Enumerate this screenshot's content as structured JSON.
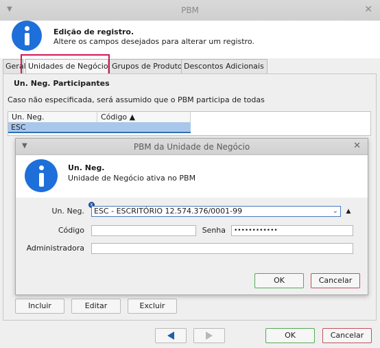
{
  "window": {
    "title": "PBM"
  },
  "header": {
    "title": "Edição de registro.",
    "subtitle": "Altere os campos desejados para alterar um registro."
  },
  "tabs": [
    {
      "label": "Geral"
    },
    {
      "label": "Unidades de Negócio"
    },
    {
      "label": "Grupos de Produto"
    },
    {
      "label": "Descontos Adicionais"
    }
  ],
  "section": {
    "title": "Un. Neg. Participantes",
    "note": "Caso não especificada, será assumido que o PBM participa de todas"
  },
  "grid": {
    "columns": [
      "Un. Neg.",
      "Código ▲"
    ],
    "rows": [
      {
        "un_neg": "ESC",
        "codigo": ""
      }
    ]
  },
  "dialog": {
    "title": "PBM da Unidade de Negócio",
    "header_title": "Un. Neg.",
    "header_subtitle": "Unidade de Negócio ativa no PBM",
    "labels": {
      "un_neg": "Un. Neg.",
      "codigo": "Código",
      "senha": "Senha",
      "administradora": "Administradora"
    },
    "values": {
      "un_neg": "ESC - ESCRITÓRIO 12.574.376/0001-99",
      "codigo": "",
      "senha": "••••••••••••",
      "administradora": ""
    },
    "ok_label": "OK",
    "cancel_label": "Cancelar"
  },
  "grid_buttons": {
    "incluir": "Incluir",
    "editar": "Editar",
    "excluir": "Excluir"
  },
  "footer": {
    "ok_label": "OK",
    "cancel_label": "Cancelar"
  },
  "colors": {
    "accent": "#1e6fd9",
    "highlight": "#d4145a",
    "ok_border": "#57a957",
    "cancel_border": "#c0505a",
    "selection": "#a9c7eb"
  }
}
